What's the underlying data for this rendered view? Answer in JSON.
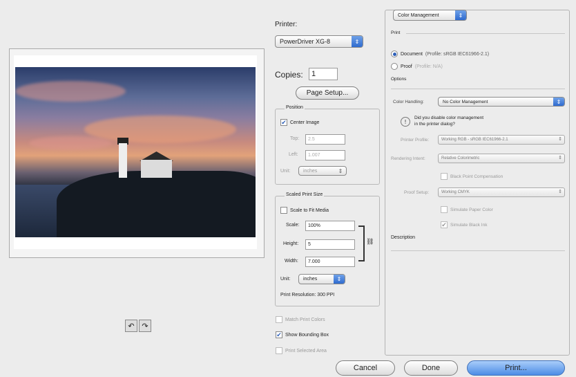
{
  "preview": {
    "rotate_left_icon": "rotate-left-icon",
    "rotate_right_icon": "rotate-right-icon"
  },
  "printer": {
    "label": "Printer:",
    "value": "PowerDriver XG-8"
  },
  "copies": {
    "label": "Copies:",
    "value": "1"
  },
  "page_setup_label": "Page Setup...",
  "position": {
    "title": "Position",
    "center_image_label": "Center Image",
    "top_label": "Top:",
    "top_value": "2.5",
    "left_label": "Left:",
    "left_value": "1.007",
    "unit_label": "Unit:",
    "unit_value": "inches"
  },
  "scaled": {
    "title": "Scaled Print Size",
    "scale_to_fit_label": "Scale to Fit Media",
    "scale_label": "Scale:",
    "scale_value": "100%",
    "height_label": "Height:",
    "height_value": "5",
    "width_label": "Width:",
    "width_value": "7.000",
    "unit_label": "Unit:",
    "unit_value": "inches",
    "resolution_text": "Print Resolution: 300 PPI"
  },
  "options_bottom": {
    "match_print_colors": "Match Print Colors",
    "show_bounding_box": "Show Bounding Box",
    "print_selected_area": "Print Selected Area"
  },
  "color_panel": {
    "section_popup": "Color Management",
    "print_label": "Print",
    "document_label": "Document",
    "document_profile": "(Profile: sRGB IEC61966-2.1)",
    "proof_label": "Proof",
    "proof_profile": "(Profile: N/A)",
    "options_label": "Options",
    "color_handling_label": "Color Handling:",
    "color_handling_value": "No Color Management",
    "info_text_1": "Did you disable color management",
    "info_text_2": "in the printer dialog?",
    "printer_profile_label": "Printer Profile:",
    "printer_profile_value": "Working RGB - sRGB IEC61966-2.1",
    "rendering_intent_label": "Rendering Intent:",
    "rendering_intent_value": "Relative Colorimetric",
    "black_point_label": "Black Point Compensation",
    "proof_setup_label": "Proof Setup:",
    "proof_setup_value": "Working CMYK",
    "simulate_paper_label": "Simulate Paper Color",
    "simulate_black_label": "Simulate Black Ink",
    "description_label": "Description"
  },
  "buttons": {
    "cancel": "Cancel",
    "done": "Done",
    "print": "Print..."
  },
  "icons": {
    "checkmark": "✔",
    "updown": "⇕",
    "info": "!",
    "link": "⛓"
  }
}
